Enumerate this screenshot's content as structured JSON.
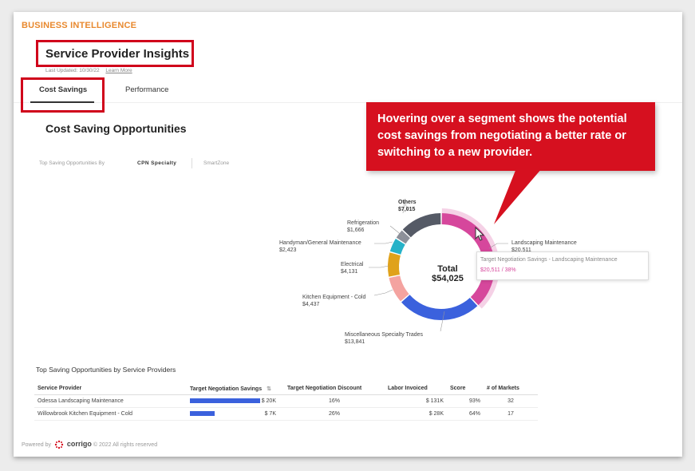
{
  "brand": "BUSINESS INTELLIGENCE",
  "header": {
    "title": "Service Provider Insights",
    "last_updated": "Last Updated: 10/30/22",
    "learn_more": "Learn More"
  },
  "tabs": [
    {
      "label": "Cost Savings",
      "active": true
    },
    {
      "label": "Performance",
      "active": false
    }
  ],
  "section_title": "Cost Saving Opportunities",
  "filters": {
    "label": "Top Saving Opportunities By",
    "options": [
      "CPN Specialty",
      "SmartZone"
    ],
    "selected": "CPN Specialty"
  },
  "callout": {
    "text": "Hovering over a segment shows the potential cost savings from negotiating a better rate or switching to a new provider."
  },
  "chart_data": {
    "type": "pie",
    "variant": "donut",
    "center_label": "Total",
    "center_value": "$54,025",
    "total": 54025,
    "slices": [
      {
        "name": "Landscaping Maintenance",
        "value": 20511,
        "label_value": "$20,511",
        "color": "#d6479c",
        "highlighted": true
      },
      {
        "name": "Miscellaneous Specialty Trades",
        "value": 13841,
        "label_value": "$13,841",
        "color": "#3b61dd"
      },
      {
        "name": "Kitchen Equipment - Cold",
        "value": 4437,
        "label_value": "$4,437",
        "color": "#f4a3a0"
      },
      {
        "name": "Electrical",
        "value": 4131,
        "label_value": "$4,131",
        "color": "#e0a21b"
      },
      {
        "name": "Handyman/General Maintenance",
        "value": 2423,
        "label_value": "$2,423",
        "color": "#27b2c8"
      },
      {
        "name": "Refrigeration",
        "value": 1666,
        "label_value": "$1,666",
        "color": "#8c8f99"
      },
      {
        "name": "Others",
        "value": 7015,
        "label_value": "$7,015",
        "color": "#555a66"
      }
    ],
    "tooltip": {
      "title": "Target Negotiation Savings - Landscaping Maintenance",
      "value": "$20,511 / 38%"
    }
  },
  "table": {
    "title": "Top Saving Opportunities by Service Providers",
    "columns": [
      "Service Provider",
      "Target Negotiation Savings",
      "Target Negotiation Discount",
      "Labor Invoiced",
      "Score",
      "# of Markets"
    ],
    "rows": [
      {
        "provider": "Odessa Landscaping Maintenance",
        "savings": "$ 20K",
        "savings_value": 20,
        "discount": "16%",
        "labor": "$ 131K",
        "score": "93%",
        "markets": "32"
      },
      {
        "provider": "Willowbrook Kitchen Equipment - Cold",
        "savings": "$ 7K",
        "savings_value": 7,
        "discount": "26%",
        "labor": "$ 28K",
        "score": "64%",
        "markets": "17"
      }
    ]
  },
  "footer": {
    "powered_by": "Powered by",
    "logo": "corrigo",
    "copyright": "© 2022 All rights reserved"
  },
  "colors": {
    "brand": "#e8892f",
    "highlight_box": "#d0021b",
    "callout_bg": "#d6101f",
    "bar": "#3b61dd"
  }
}
